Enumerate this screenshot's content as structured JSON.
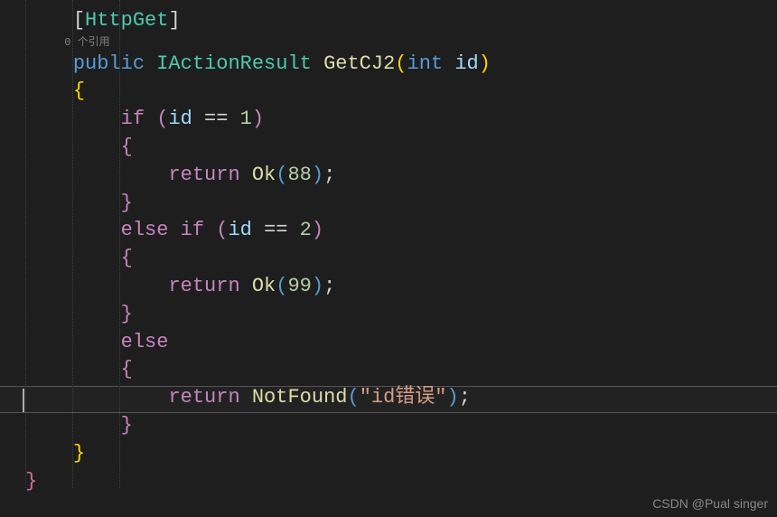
{
  "code": {
    "attr_open": "[",
    "attr_name": "HttpGet",
    "attr_close": "]",
    "codelens": "0 个引用",
    "kw_public": "public",
    "type_iaction": "IActionResult",
    "method_name": "GetCJ2",
    "kw_int": "int",
    "param_id": "id",
    "brace_open": "{",
    "brace_close": "}",
    "paren_open": "(",
    "paren_close": ")",
    "kw_if": "if",
    "kw_else": "else",
    "kw_return": "return",
    "method_ok": "Ok",
    "method_notfound": "NotFound",
    "op_eq": "==",
    "num_1": "1",
    "num_2": "2",
    "num_88": "88",
    "num_99": "99",
    "str_iderr": "\"id错误\"",
    "semi": ";"
  },
  "watermark": "CSDN @Pual singer"
}
